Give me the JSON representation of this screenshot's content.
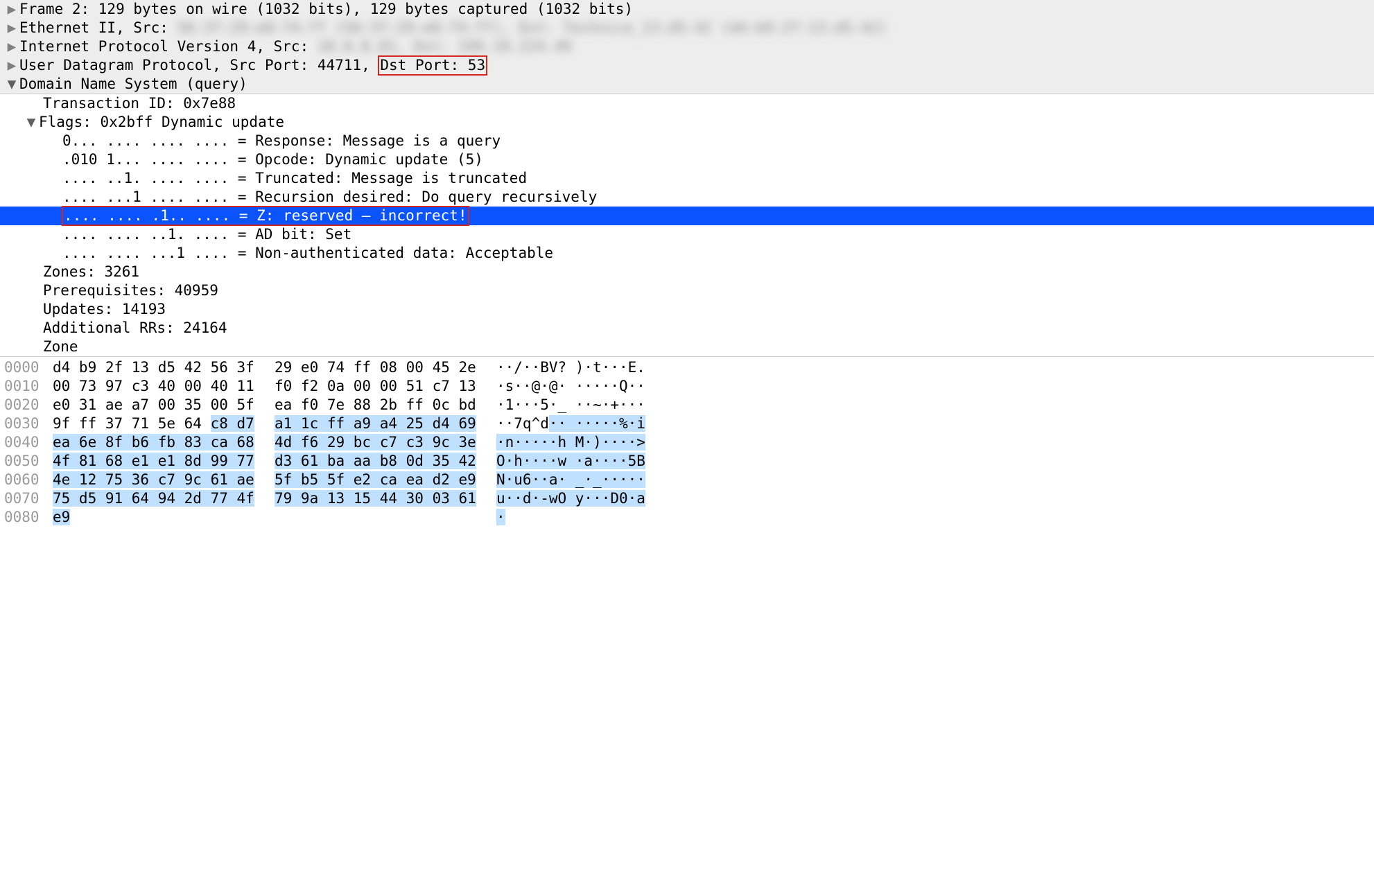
{
  "tree": {
    "frame": "Frame 2: 129 bytes on wire (1032 bits), 129 bytes captured (1032 bits)",
    "eth_prefix": "Ethernet II, Src: ",
    "eth_blur": "56:3f:29:e0:74:ff (56:3f:29:e0:74:ff), Dst: Technico_13:d5:42 (d4:b9:2f:13:d5:42)",
    "ip_prefix": "Internet Protocol Version 4, Src: ",
    "ip_blur": "10.0.0.81, Dst: 199.19.224.49",
    "udp_prefix": "User Datagram Protocol, Src Port: 44711, ",
    "udp_dst": "Dst Port: 53",
    "dns_header": "Domain Name System (query)",
    "txid": "Transaction ID: 0x7e88",
    "flags_header": "Flags: 0x2bff Dynamic update",
    "flag_response": "0... .... .... .... = Response: Message is a query",
    "flag_opcode": ".010 1... .... .... = Opcode: Dynamic update (5)",
    "flag_trunc": ".... ..1. .... .... = Truncated: Message is truncated",
    "flag_rd": ".... ...1 .... .... = Recursion desired: Do query recursively",
    "flag_z": ".... .... .1.. .... = Z: reserved – incorrect!",
    "flag_ad": ".... .... ..1. .... = AD bit: Set",
    "flag_nad": ".... .... ...1 .... = Non-authenticated data: Acceptable",
    "zones": "Zones: 3261",
    "prereq": "Prerequisites: 40959",
    "updates": "Updates: 14193",
    "addl": "Additional RRs: 24164",
    "zone": "Zone"
  },
  "hex": [
    {
      "off": "0000",
      "l": "d4 b9 2f 13 d5 42 56 3f",
      "r": "29 e0 74 ff 08 00 45 2e",
      "a": "··/··BV? )·t···E."
    },
    {
      "off": "0010",
      "l": "00 73 97 c3 40 00 40 11",
      "r": "f0 f2 0a 00 00 51 c7 13",
      "a": "·s··@·@· ·····Q··"
    },
    {
      "off": "0020",
      "l": "e0 31 ae a7 00 35 00 5f",
      "r": "ea f0 7e 88 2b ff 0c bd",
      "a": "·1···5·_ ··~·+···"
    },
    {
      "off": "0030",
      "l": "9f ff 37 71 5e 64 ",
      "l_hl": "c8 d7",
      "r_hl": "a1 1c ff a9 a4 25 d4 69",
      "a": "··7q^d",
      "a_hl": "·· ·····%·i"
    },
    {
      "off": "0040",
      "l_hl": "ea 6e 8f b6 fb 83 ca 68",
      "r_hl": "4d f6 29 bc c7 c3 9c 3e",
      "a_hl": "·n·····h M·)····>"
    },
    {
      "off": "0050",
      "l_hl": "4f 81 68 e1 e1 8d 99 77",
      "r_hl": "d3 61 ba aa b8 0d 35 42",
      "a_hl": "O·h····w ·a····5B"
    },
    {
      "off": "0060",
      "l_hl": "4e 12 75 36 c7 9c 61 ae",
      "r_hl": "5f b5 5f e2 ca ea d2 e9",
      "a_hl": "N·u6··a· _·_·····"
    },
    {
      "off": "0070",
      "l_hl": "75 d5 91 64 94 2d 77 4f",
      "r_hl": "79 9a 13 15 44 30 03 61",
      "a_hl": "u··d·-wO y···D0·a"
    },
    {
      "off": "0080",
      "l_hl": "e9",
      "r": "",
      "a_hl": "·"
    }
  ],
  "glyph": {
    "closed": "▶",
    "open": "▼"
  }
}
